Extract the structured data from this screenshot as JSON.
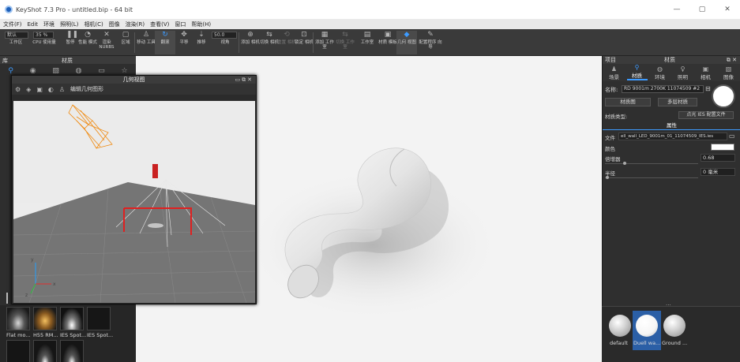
{
  "window": {
    "title": "KeyShot 7.3 Pro - untitled.bip - 64 bit",
    "controls": [
      "—",
      "▢",
      "✕"
    ]
  },
  "menu": [
    "文件(F)",
    "Edit",
    "环境",
    "照明(L)",
    "相机(C)",
    "图像",
    "渲染(R)",
    "查看(V)",
    "窗口",
    "帮助(H)"
  ],
  "toolbar": {
    "workspace_select": "默认",
    "zoom_select": "35 %",
    "fov_value": "50.0",
    "groups": [
      [
        "工作区",
        "CPU 使用量",
        "暂停",
        "性能 模式",
        "渲染 NURBS",
        "区域",
        "移动 工具",
        "翻滚",
        "平移",
        "推移",
        "视角"
      ],
      [
        "添加 相机",
        "切换 相机",
        "重置 相机",
        "锁定 相机",
        "添加 工作室",
        "切换 工作室",
        "工作室",
        "材质 模板",
        "几何 视图",
        "配置程序 向导"
      ]
    ]
  },
  "library_panel": {
    "title": "库",
    "subtitle": "材质"
  },
  "geometry_view": {
    "title": "几何视图",
    "edit_label": "编辑几何图形",
    "axis_labels": [
      "y",
      "x",
      "z"
    ]
  },
  "left_thumbnails": [
    {
      "label": "Flat mo..."
    },
    {
      "label": "H55 RM..."
    },
    {
      "label": "IES Spot..."
    },
    {
      "label": "IES Spot..."
    }
  ],
  "right_panel": {
    "header_left": "项目",
    "header_center": "材质",
    "tabs": [
      {
        "label": "场景",
        "icon": "scene-icon"
      },
      {
        "label": "材质",
        "icon": "material-icon"
      },
      {
        "label": "环境",
        "icon": "environment-icon"
      },
      {
        "label": "照明",
        "icon": "lighting-icon"
      },
      {
        "label": "相机",
        "icon": "camera-icon"
      },
      {
        "label": "图像",
        "icon": "image-icon"
      }
    ],
    "name_label": "名称:",
    "name_value": "RD 9001m 2700K 11074509 #2",
    "material_graph_button": "材质图",
    "multilayer_button": "多层材质",
    "material_type_label": "材质类型:",
    "material_type_value": "点光 IES 配置文件",
    "section_title": "属性",
    "file_label": "文件",
    "file_value": "ell_wall_LED_9001m_01_11074509_IES.ies",
    "color_label": "颜色",
    "multiplier_label": "倍增器",
    "multiplier_value": "0.68",
    "radius_label": "半径",
    "radius_value": "0 毫米",
    "more_dots": "...",
    "colors": {
      "accent": "#3d9bff",
      "selected": "#2b5fa6"
    }
  },
  "material_thumbnails": [
    {
      "label": "default"
    },
    {
      "label": "Duell wa..."
    },
    {
      "label": "Ground ..."
    }
  ]
}
